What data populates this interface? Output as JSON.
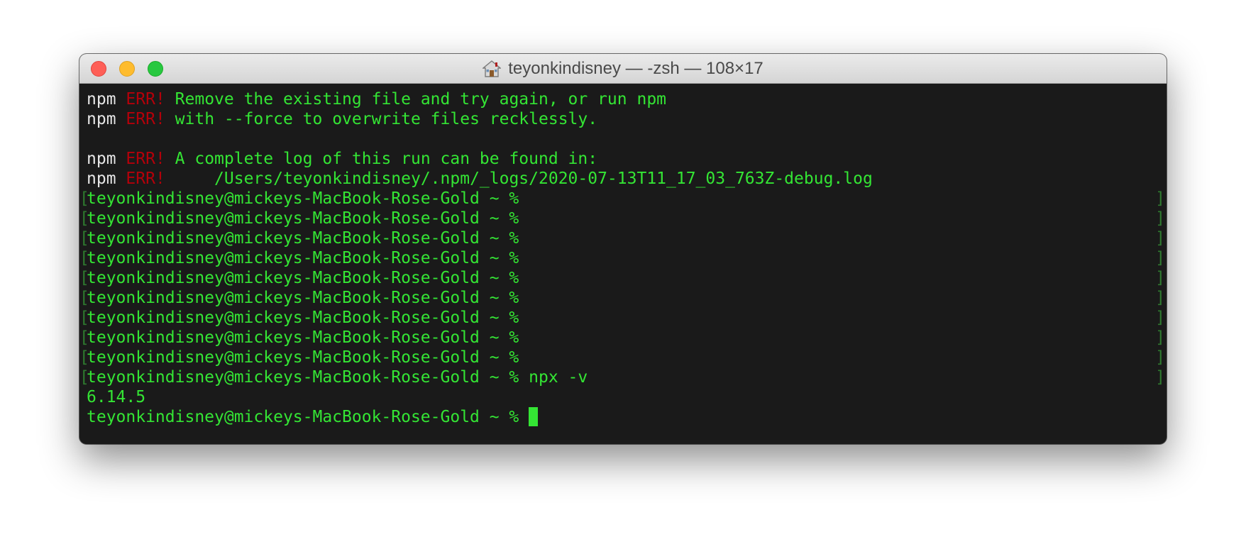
{
  "window": {
    "title": "teyonkindisney — -zsh — 108×17",
    "colors": {
      "background": "#1a1a1a",
      "text": "#34e534",
      "npm_label": "#e6e6e6",
      "err": "#b3000a",
      "close": "#fe5f57",
      "minimize": "#febc2e",
      "maximize": "#28c840"
    }
  },
  "terminal": {
    "npm_label": "npm",
    "err_label": "ERR!",
    "err_lines": [
      "Remove the existing file and try again, or run npm",
      "with --force to overwrite files recklessly.",
      "A complete log of this run can be found in:",
      "    /Users/teyonkindisney/.npm/_logs/2020-07-13T11_17_03_763Z-debug.log"
    ],
    "prompt": "teyonkindisney@mickeys-MacBook-Rose-Gold ~ %",
    "command": " npx -v",
    "output": "6.14.5",
    "bracket_left": "[",
    "bracket_right": "]"
  }
}
